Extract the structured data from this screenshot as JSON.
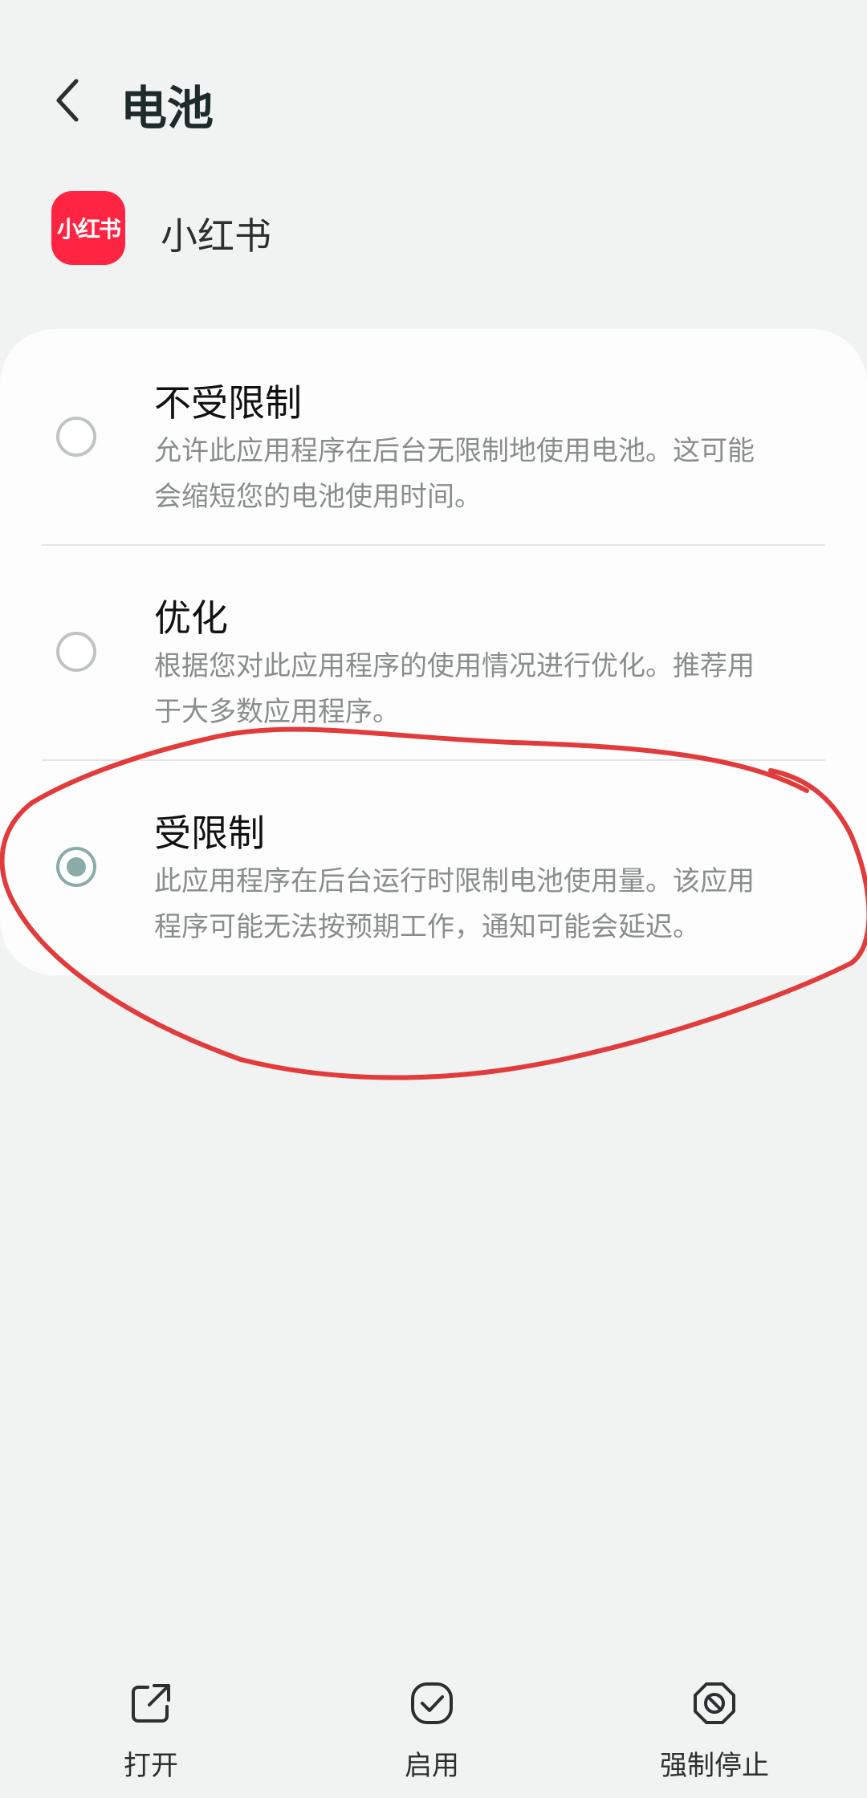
{
  "header": {
    "title": "电池"
  },
  "app": {
    "name": "小红书",
    "icon_text": "小红书",
    "icon_color": "#ff2442"
  },
  "options": [
    {
      "title": "不受限制",
      "desc": "允许此应用程序在后台无限制地使用电池。这可能会缩短您的电池使用时间。",
      "selected": false
    },
    {
      "title": "优化",
      "desc": "根据您对此应用程序的使用情况进行优化。推荐用于大多数应用程序。",
      "selected": false
    },
    {
      "title": "受限制",
      "desc": "此应用程序在后台运行时限制电池使用量。该应用程序可能无法按预期工作，通知可能会延迟。",
      "selected": true
    }
  ],
  "bottom_bar": {
    "open_label": "打开",
    "enable_label": "启用",
    "force_stop_label": "强制停止"
  },
  "colors": {
    "accent": "#8aaba8",
    "annotation": "#e23b3b",
    "background": "#f1f2f2"
  }
}
